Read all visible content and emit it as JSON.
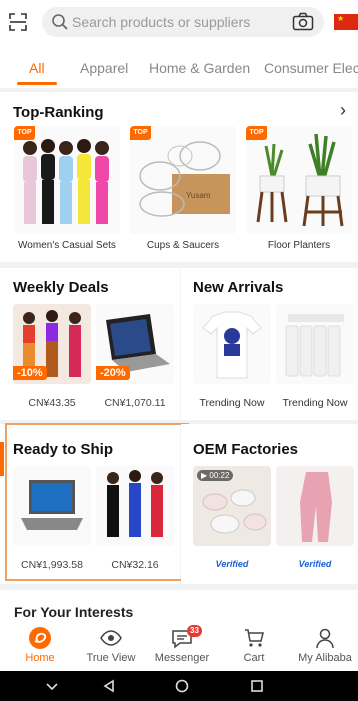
{
  "search": {
    "placeholder": "Search products or suppliers",
    "icon": "search-icon"
  },
  "tabs": [
    {
      "label": "All",
      "active": true
    },
    {
      "label": "Apparel",
      "active": false
    },
    {
      "label": "Home & Garden",
      "active": false
    },
    {
      "label": "Consumer Electronics",
      "active": false
    }
  ],
  "top_ranking": {
    "title": "Top-Ranking",
    "badge": "TOP",
    "items": [
      {
        "caption": "Women's Casual Sets"
      },
      {
        "caption": "Cups & Saucers"
      },
      {
        "caption": "Floor Planters"
      }
    ]
  },
  "weekly_deals": {
    "title": "Weekly Deals",
    "items": [
      {
        "discount": "-10%",
        "price": "CN¥43.35"
      },
      {
        "discount": "-20%",
        "price": "CN¥1,070.11"
      }
    ]
  },
  "new_arrivals": {
    "title": "New Arrivals",
    "items": [
      {
        "caption": "Trending Now"
      },
      {
        "caption": "Trending Now"
      }
    ]
  },
  "ready_to_ship": {
    "title": "Ready to Ship",
    "items": [
      {
        "price": "CN¥1,993.58"
      },
      {
        "price": "CN¥32.16"
      }
    ]
  },
  "oem_factories": {
    "title": "OEM Factories",
    "video_time": "00:22",
    "items": [
      {
        "label": "Verified"
      },
      {
        "label": "Verified"
      }
    ]
  },
  "interests": {
    "title": "For Your Interests"
  },
  "bottom_nav": {
    "items": [
      {
        "label": "Home",
        "icon": "alibaba-home-icon",
        "active": true
      },
      {
        "label": "True View",
        "icon": "eye-icon",
        "active": false
      },
      {
        "label": "Messenger",
        "icon": "message-icon",
        "active": false,
        "badge": "33"
      },
      {
        "label": "Cart",
        "icon": "cart-icon",
        "active": false
      },
      {
        "label": "My Alibaba",
        "icon": "person-icon",
        "active": false
      }
    ]
  },
  "colors": {
    "accent": "#ff6a00",
    "verified": "#1a5fd6",
    "badge": "#e53935"
  }
}
